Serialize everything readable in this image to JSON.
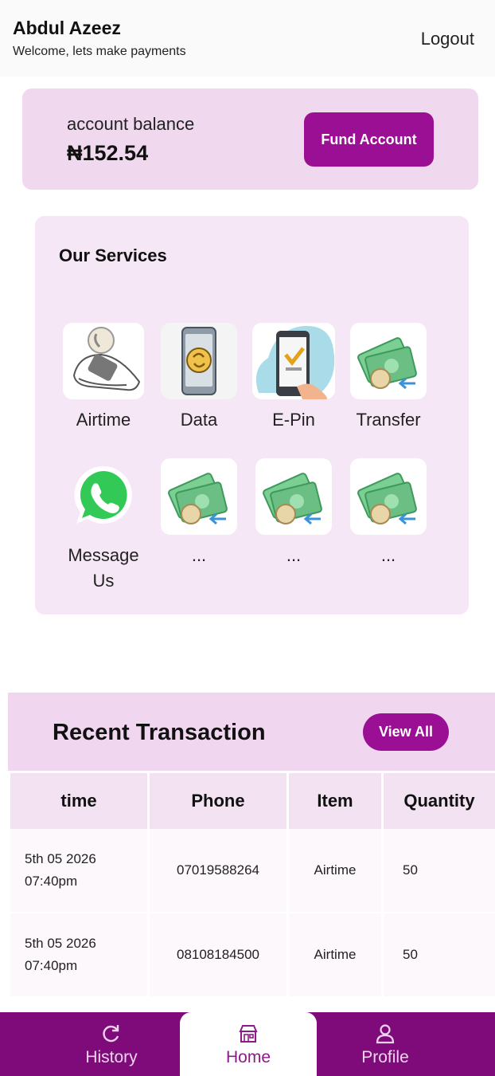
{
  "header": {
    "user_name": "Abdul Azeez",
    "welcome": "Welcome, lets make payments",
    "logout_label": "Logout"
  },
  "balance": {
    "label": "account balance",
    "value": "₦152.54",
    "fund_label": "Fund Account"
  },
  "services": {
    "title": "Our Services",
    "items": [
      {
        "label": "Airtime",
        "icon": "airtime-icon"
      },
      {
        "label": "Data",
        "icon": "data-icon"
      },
      {
        "label": "E-Pin",
        "icon": "epin-icon"
      },
      {
        "label": "Transfer",
        "icon": "money-transfer-icon"
      },
      {
        "label": "Message Us",
        "icon": "whatsapp-icon"
      },
      {
        "label": "...",
        "icon": "money-transfer-icon"
      },
      {
        "label": "...",
        "icon": "money-transfer-icon"
      },
      {
        "label": "...",
        "icon": "money-transfer-icon"
      }
    ]
  },
  "transactions": {
    "title": "Recent Transaction",
    "view_all_label": "View All",
    "columns": [
      "time",
      "Phone",
      "Item",
      "Quantity"
    ],
    "rows": [
      {
        "date": "5th 05 2026",
        "time": "07:40pm",
        "phone": "07019588264",
        "item": "Airtime",
        "quantity": "50"
      },
      {
        "date": "5th 05 2026",
        "time": "07:40pm",
        "phone": "08108184500",
        "item": "Airtime",
        "quantity": "50"
      }
    ]
  },
  "nav": {
    "items": [
      {
        "label": "History",
        "icon": "refresh-icon"
      },
      {
        "label": "Home",
        "icon": "store-icon",
        "active": true
      },
      {
        "label": "Profile",
        "icon": "user-icon"
      }
    ]
  },
  "colors": {
    "accent": "#9a0f93",
    "nav_bg": "#7f0b7b",
    "card_bg": "#f0d8ef",
    "services_bg": "#f5e7f5"
  }
}
